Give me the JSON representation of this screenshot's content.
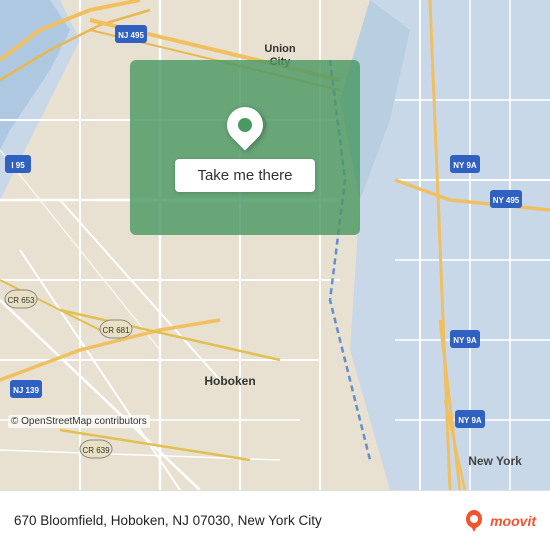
{
  "map": {
    "alt": "Map of Hoboken, NJ area"
  },
  "overlay": {
    "button_label": "Take me there"
  },
  "bottom_bar": {
    "address": "670 Bloomfield, Hoboken, NJ 07030,",
    "city": "New York City",
    "osm_credit": "© OpenStreetMap contributors",
    "logo_text": "moovit"
  },
  "icons": {
    "location_pin": "location-pin-icon",
    "moovit_pin": "moovit-logo-icon"
  }
}
